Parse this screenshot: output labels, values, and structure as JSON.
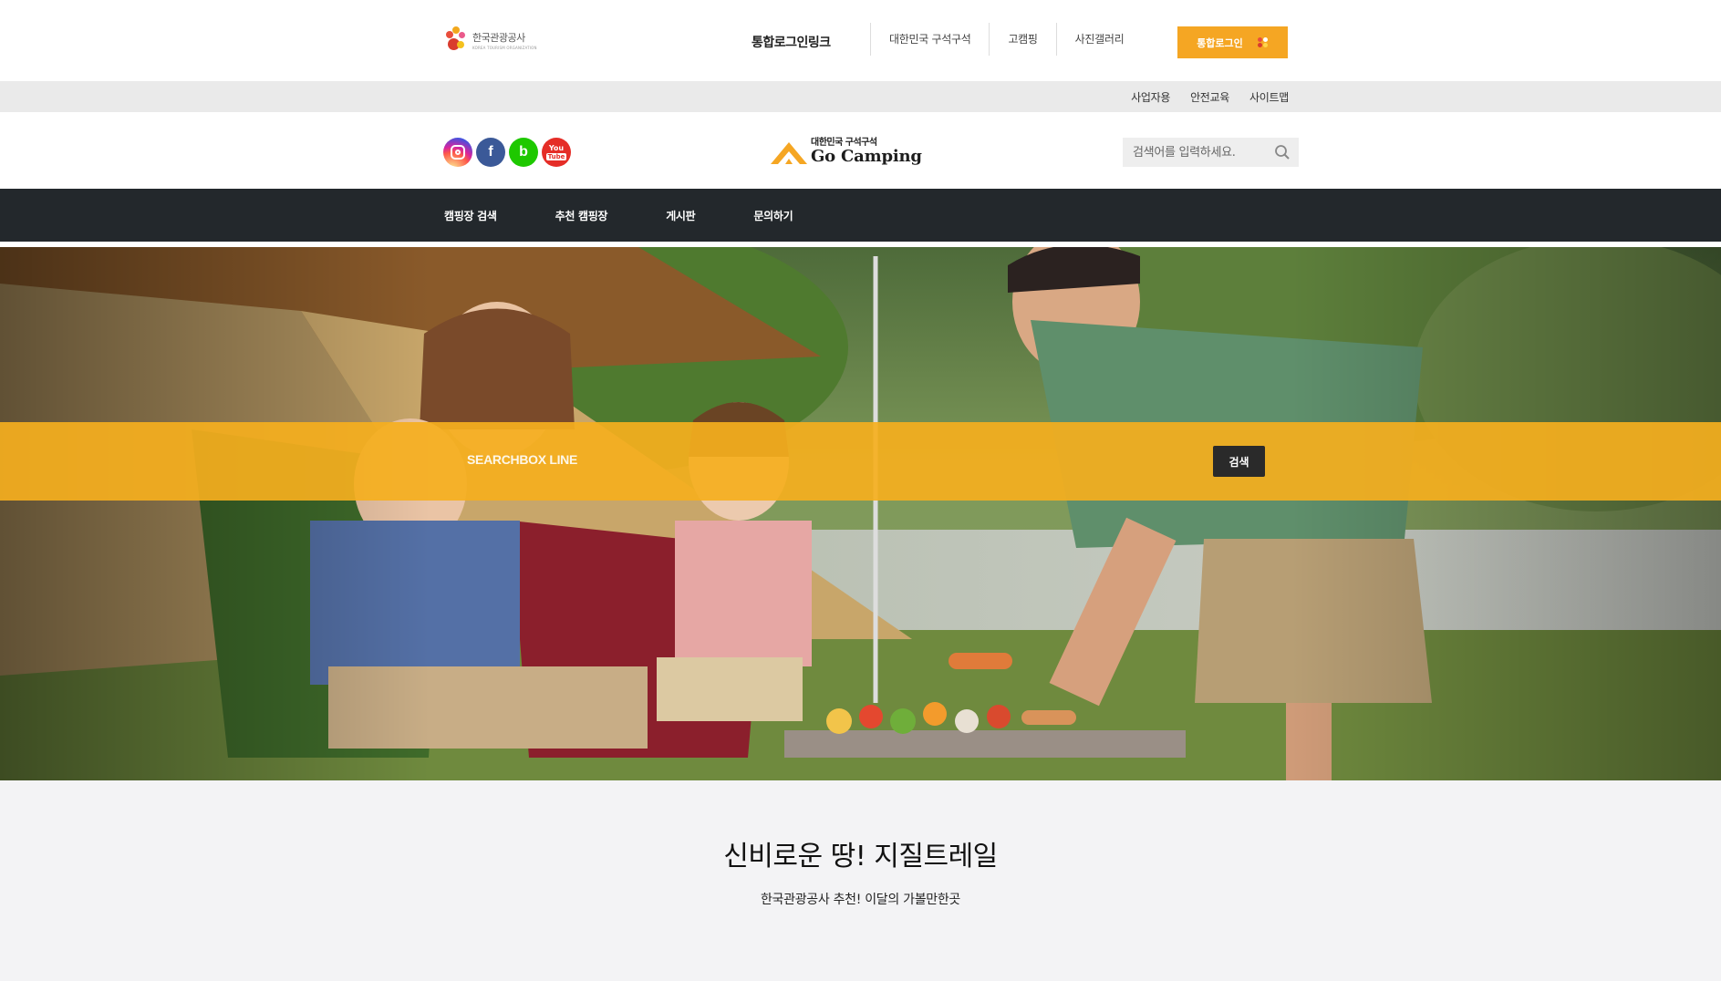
{
  "utility": {
    "org_logo_text": "한국관광공사",
    "org_logo_subtext": "KOREA TOURISM ORGANIZATION",
    "title": "통합로그인링크",
    "links": [
      "대한민국 구석구석",
      "고캠핑",
      "사진갤러리"
    ],
    "login_label": "통합로그인",
    "login_color": "#f5a623"
  },
  "subbar": {
    "links": [
      "사업자용",
      "안전교육",
      "사이트맵"
    ]
  },
  "header": {
    "socials": [
      {
        "icon": "instagram-icon"
      },
      {
        "icon": "facebook-icon",
        "glyph": "f"
      },
      {
        "icon": "band-icon",
        "glyph": "b"
      },
      {
        "icon": "youtube-icon",
        "glyph_top": "You",
        "glyph_box": "Tube"
      }
    ],
    "brand_sub": "대한민국 구석구석",
    "brand_name": "Go Camping",
    "brand_color": "#f5a623",
    "search_placeholder": "검색어를 입력하세요."
  },
  "nav": {
    "items": [
      "캠핑장 검색",
      "추천 캠핑장",
      "게시판",
      "문의하기"
    ],
    "background": "#23282c"
  },
  "hero": {
    "band_label": "SEARCHBOX LINE",
    "band_button": "검색",
    "band_color": "#f5af1e"
  },
  "featured": {
    "title": "신비로운 땅! 지질트레일",
    "subtitle": "한국관광공사 추천! 이달의 가볼만한곳"
  }
}
